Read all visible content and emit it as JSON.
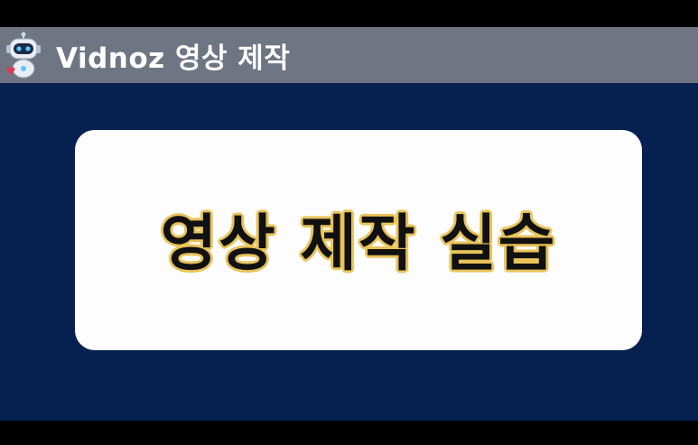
{
  "header": {
    "title": "Vidnoz 영상 제작",
    "logo_icon": "robot-mascot-icon",
    "background_color": "#6f7582"
  },
  "slide": {
    "title": "영상 제작 실습",
    "background_color": "#062150",
    "card_color": "#fdfdfd",
    "title_outline_color": "#e8c35a"
  }
}
